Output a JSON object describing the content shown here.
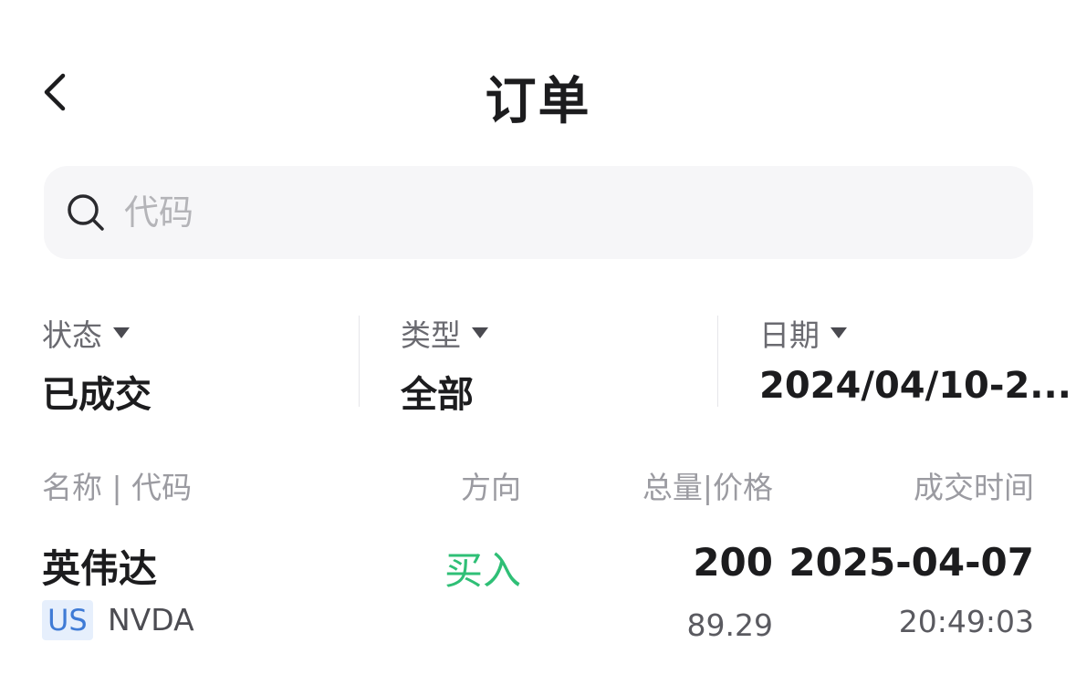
{
  "header": {
    "title": "订单",
    "back_icon": "chevron-left-icon"
  },
  "search": {
    "placeholder": "代码",
    "value": "",
    "icon": "search-icon"
  },
  "filters": [
    {
      "label": "状态",
      "value": "已成交"
    },
    {
      "label": "类型",
      "value": "全部"
    },
    {
      "label": "日期",
      "value": "2024/04/10-2..."
    }
  ],
  "table": {
    "columns": [
      "名称 | 代码",
      "方向",
      "总量|价格",
      "成交时间"
    ],
    "rows": [
      {
        "name": "英伟达",
        "market": "US",
        "code": "NVDA",
        "direction": "买入",
        "quantity": "200",
        "price": "89.29",
        "date": "2025-04-07",
        "time": "20:49:03"
      }
    ]
  },
  "colors": {
    "buy": "#2fbf76",
    "market_badge_bg": "#e6effc",
    "market_badge_text": "#3f7bd6",
    "search_bg": "#f6f6f8"
  }
}
